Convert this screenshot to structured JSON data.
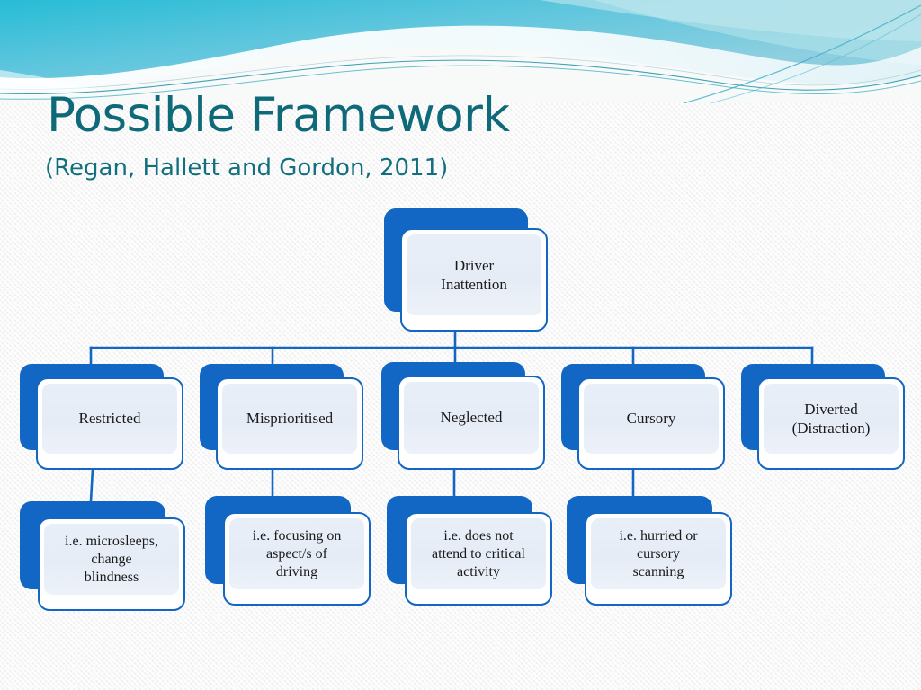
{
  "slide": {
    "title": "Possible Framework",
    "subtitle": "(Regan, Hallett and Gordon, 2011)",
    "background_color": "#f6f6f6",
    "title_color": "#0E6A78",
    "accent_blue": "#1167C3",
    "card_fill": "#e8eef7"
  },
  "chart_data": {
    "type": "diagram",
    "title": "Possible Framework",
    "subtitle": "(Regan, Hallett and Gordon, 2011)",
    "root": {
      "id": "root",
      "label": "Driver\nInattention"
    },
    "level2": [
      {
        "id": "restricted",
        "label": "Restricted"
      },
      {
        "id": "misprioritised",
        "label": "Misprioritised"
      },
      {
        "id": "neglected",
        "label": "Neglected"
      },
      {
        "id": "cursory",
        "label": "Cursory"
      },
      {
        "id": "diverted",
        "label": "Diverted\n(Distraction)"
      }
    ],
    "level3": [
      {
        "id": "ex-restricted",
        "parent": "restricted",
        "label": "i.e. microsleeps,\nchange\nblindness"
      },
      {
        "id": "ex-misprioritised",
        "parent": "misprioritised",
        "label": "i.e. focusing on\naspect/s of\ndriving"
      },
      {
        "id": "ex-neglected",
        "parent": "neglected",
        "label": "i.e. does not\nattend to critical\nactivity"
      },
      {
        "id": "ex-cursory",
        "parent": "cursory",
        "label": "i.e. hurried or\ncursory\nscanning"
      }
    ]
  },
  "nodes": {
    "root": "Driver\nInattention",
    "restricted": "Restricted",
    "misprioritised": "Misprioritised",
    "neglected": "Neglected",
    "cursory": "Cursory",
    "diverted": "Diverted\n(Distraction)",
    "ex_restricted": "i.e. microsleeps,\nchange\nblindness",
    "ex_misprioritised": "i.e. focusing on\naspect/s of\ndriving",
    "ex_neglected": "i.e. does not\nattend to critical\nactivity",
    "ex_cursory": "i.e. hurried or\ncursory\nscanning"
  }
}
